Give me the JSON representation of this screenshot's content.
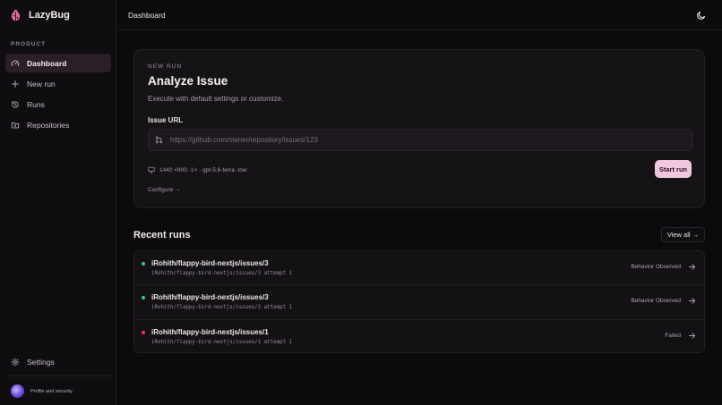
{
  "app": {
    "name": "LazyBug",
    "accent": "#f2c6dc"
  },
  "sidebar": {
    "section_label": "PRODUCT",
    "items": [
      {
        "label": "Dashboard",
        "icon": "gauge-icon",
        "active": true
      },
      {
        "label": "New run",
        "icon": "plus-icon"
      },
      {
        "label": "Runs",
        "icon": "history-icon"
      },
      {
        "label": "Repositories",
        "icon": "folder-git-icon"
      }
    ],
    "settings_label": "Settings",
    "profile_label": "Profile and security"
  },
  "header": {
    "title": "Dashboard",
    "theme_icon": "moon-icon"
  },
  "new_run": {
    "eyebrow": "NEW RUN",
    "title": "Analyze Issue",
    "subtitle": "Execute with default settings or customize.",
    "field_label": "Issue URL",
    "url_placeholder": "https://github.com/owner/repository/issues/123",
    "meta": "1440 ×900 ·1× · gpt-5.6-terra ·low",
    "configure_label": "Configure →",
    "start_label": "Start run"
  },
  "recent": {
    "title": "Recent runs",
    "view_all_label": "View all →",
    "runs": [
      {
        "title": "iRohith/flappy-bird-nextjs/issues/3",
        "sub": "iRohith/flappy-bird-nextjs/issues/3 attempt 1",
        "status": "Behavior Observed",
        "status_color": "#2ecc8f"
      },
      {
        "title": "iRohith/flappy-bird-nextjs/issues/3",
        "sub": "iRohith/flappy-bird-nextjs/issues/3 attempt 1",
        "status": "Behavior Observed",
        "status_color": "#2ecc8f"
      },
      {
        "title": "iRohith/flappy-bird-nextjs/issues/1",
        "sub": "iRohith/flappy-bird-nextjs/issues/1 attempt 1",
        "status": "Failed",
        "status_color": "#e8365d"
      }
    ]
  }
}
